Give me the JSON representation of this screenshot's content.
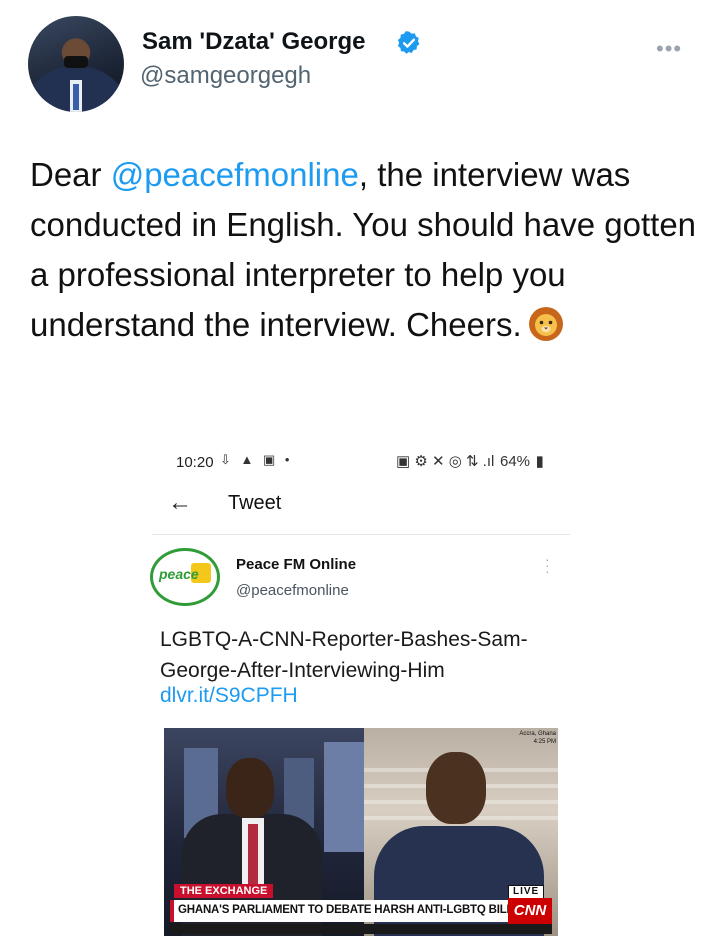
{
  "author": {
    "name": "Sam 'Dzata' George",
    "handle": "@samgeorgegh",
    "verified": true,
    "more_icon": "more-dots-icon"
  },
  "tweet": {
    "prefix": "Dear ",
    "mention": "@peacefmonline",
    "body": ", the interview was conducted in English. You should have gotten a professional interpreter to help you understand the interview. Cheers.",
    "emoji": "lion-face-emoji"
  },
  "embedded": {
    "status_bar": {
      "time": "10:20",
      "left_icons": "⇩ ▲ ▣ •",
      "right_icons": "▣ ⚙ ✕ ◎ ⇅ .ıl",
      "battery": "64%"
    },
    "nav": {
      "title": "Tweet",
      "back_icon": "arrow-left-icon"
    },
    "source": {
      "name": "Peace FM Online",
      "handle": "@peacefmonline",
      "logo_text": "peace"
    },
    "headline": "LGBTQ-A-CNN-Reporter-Bashes-Sam-George-After-Interviewing-Him",
    "link": "dlvr.it/S9CPFH",
    "video": {
      "location_line1": "Accra, Ghana",
      "location_line2": "4:25 PM",
      "program_tag": "THE EXCHANGE",
      "live_tag": "LIVE",
      "lower_third": "GHANA'S PARLIAMENT TO DEBATE HARSH ANTI-LGBTQ BILL",
      "network": "CNN"
    }
  },
  "colors": {
    "link_blue": "#1d9bf0",
    "verified_blue": "#1d9bf0",
    "cnn_red": "#cc0000",
    "peace_green": "#2f9c37"
  }
}
